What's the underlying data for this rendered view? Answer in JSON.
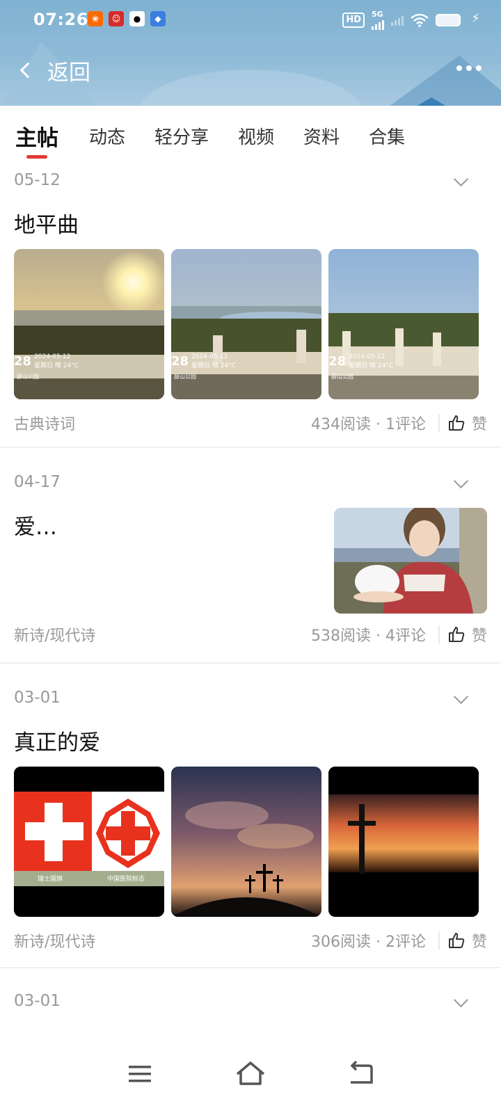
{
  "status_bar": {
    "time": "07:26",
    "hd": "HD",
    "network": "5G"
  },
  "nav": {
    "back_label": "返回"
  },
  "tabs": [
    {
      "label": "主帖",
      "active": true
    },
    {
      "label": "动态"
    },
    {
      "label": "轻分享"
    },
    {
      "label": "视频"
    },
    {
      "label": "资料"
    },
    {
      "label": "合集"
    }
  ],
  "posts": [
    {
      "date": "05-12",
      "title": "地平曲",
      "category": "古典诗词",
      "stats": "434阅读 · 1评论",
      "like_label": "赞",
      "images": [
        {
          "desc": "sunset-over-lake",
          "overlay_day": "28",
          "overlay_date": "2024-05-12",
          "overlay_weather": "星期日 晴 24°C",
          "overlay_place": "薛山公园"
        },
        {
          "desc": "lake-view-balustrade",
          "overlay_day": "28",
          "overlay_date": "2024-05-12",
          "overlay_weather": "星期日 晴 24°C",
          "overlay_place": "薛山公园"
        },
        {
          "desc": "hilltop-terrace",
          "overlay_day": "28",
          "overlay_date": "2024-05-12",
          "overlay_weather": "星期日 晴 24°C",
          "overlay_place": "薛山公园"
        }
      ]
    },
    {
      "date": "04-17",
      "title": "爱…",
      "category": "新诗/现代诗",
      "stats": "538阅读 · 4评论",
      "like_label": "赞"
    },
    {
      "date": "03-01",
      "title": "真正的爱",
      "category": "新诗/现代诗",
      "stats": "306阅读 · 2评论",
      "like_label": "赞",
      "flag_caption_left": "瑞士国旗",
      "flag_caption_right": "中国医院标志"
    },
    {
      "date": "03-01"
    }
  ],
  "colors": {
    "accent": "#e03a2f",
    "header_bg": "#8fbbd8"
  }
}
